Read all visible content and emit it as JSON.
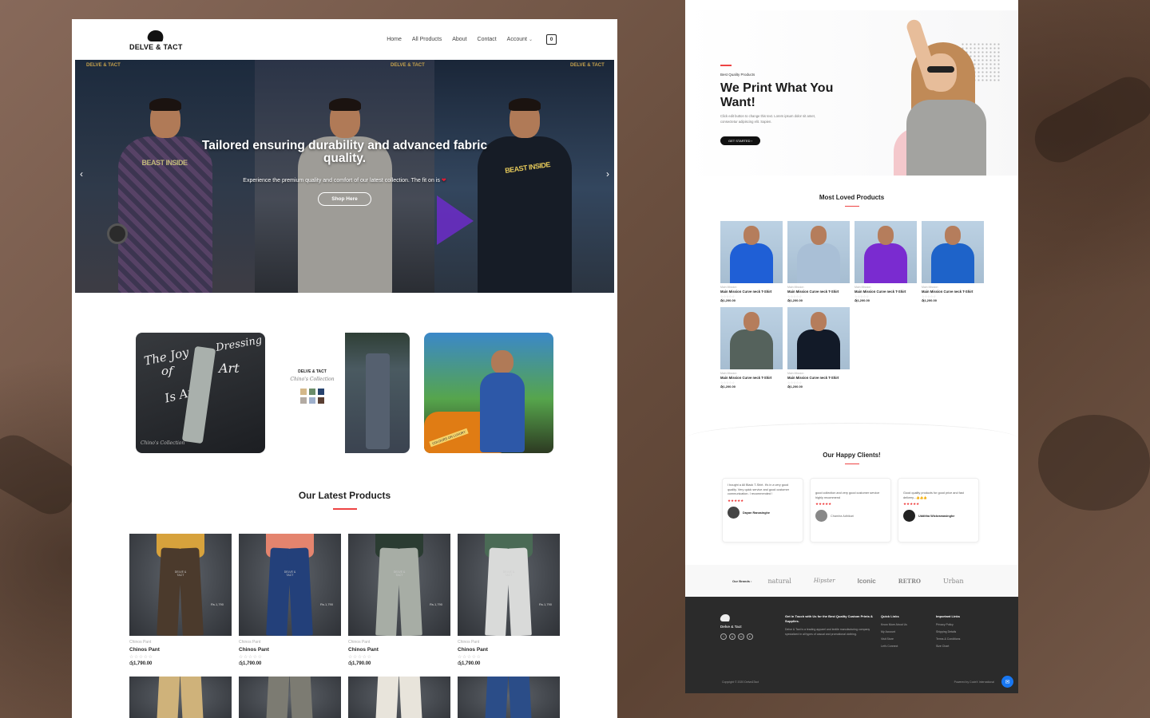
{
  "left": {
    "nav": {
      "brand": "DELVE & TACT",
      "links": [
        "Home",
        "All Products",
        "About",
        "Contact",
        "Account"
      ],
      "cart_count": "0"
    },
    "hero": {
      "brand_tag": "DELVE & TACT",
      "title": "Tailored ensuring durability and advanced fabric quality.",
      "subtitle": "Experience the premium quality and comfort of our latest collection. The fit on is",
      "button": "Shop Here",
      "panel_print_left": "BEAST INSIDE",
      "panel_print_right": "BEAST INSIDE"
    },
    "collections": {
      "card1_text": [
        "The Joy",
        "of",
        "Is An",
        "Dressing",
        "Art"
      ],
      "card1_footer": "Chino's Collection",
      "card2_brand": "DELVE & TACT",
      "card2_script": "Chino's Collection",
      "card3_plate": "COLOURS ON LUXURY"
    },
    "latest": {
      "title": "Our Latest Products",
      "products": [
        {
          "category": "Chinos Pant",
          "name": "Chinos Pant",
          "price": "රු1,790.00",
          "tag": "Rs.1,790",
          "pants": "#4b3a2c",
          "shirt": "#d7a23c"
        },
        {
          "category": "Chinos Pant",
          "name": "Chinos Pant",
          "price": "රු1,790.00",
          "tag": "Rs.1,790",
          "pants": "#23407a",
          "shirt": "#e4846e"
        },
        {
          "category": "Chinos Pant",
          "name": "Chinos Pant",
          "price": "රු1,790.00",
          "tag": "Rs.1,790",
          "pants": "#a7ada5",
          "shirt": "#2b3c32"
        },
        {
          "category": "Chinos Pant",
          "name": "Chinos Pant",
          "price": "රු1,790.00",
          "tag": "Rs.1,790",
          "pants": "#d9dad9",
          "shirt": "#4a6a55"
        }
      ],
      "stars": "☆☆☆☆☆"
    }
  },
  "right": {
    "hero": {
      "eyebrow": "Best Quality Products",
      "title": "We Print What You Want!",
      "description": "Click edit button to change this text. Lorem ipsum dolor sit amet, consectetur adipiscing elit. Sapien.",
      "button": "GET STARTED"
    },
    "most_loved": {
      "title": "Most Loved Products",
      "products": [
        {
          "category": "Main Mission",
          "name": "Main Mission Curve neck T-Shirt",
          "price": "රු1,200.00",
          "color": "#1f5fd6"
        },
        {
          "category": "Main Mission",
          "name": "Main Mission Curve neck T-Shirt",
          "price": "රු1,200.00",
          "color": "#a9bfd6"
        },
        {
          "category": "Main Mission",
          "name": "Main Mission Curve neck T-Shirt",
          "price": "රු1,200.00",
          "color": "#7a2bd0"
        },
        {
          "category": "Main Mission",
          "name": "Main Mission Curve neck T-Shirt",
          "price": "රු1,200.00",
          "color": "#1e63c9"
        },
        {
          "category": "Main Mission",
          "name": "Main Mission Curve neck T-Shirt",
          "price": "රු1,200.00",
          "color": "#55625c"
        },
        {
          "category": "Main Mission",
          "name": "Main Mission Curve neck T-Shirt",
          "price": "රු1,200.00",
          "color": "#121a28"
        }
      ],
      "stars": "☆☆☆☆☆"
    },
    "clients": {
      "title": "Our Happy Clients!",
      "reviews": [
        {
          "text": "I bought a All Black T-Shirt. It's in a very good quality. Very quick service and good customer communication. I recommended !",
          "stars": "★★★★★",
          "name": "Dayan Ranasinghe"
        },
        {
          "text": "good collection and very good customer service highly recommend",
          "stars": "★★★★★",
          "name": "Chamira Adhikari"
        },
        {
          "text": "Good quality products for good price and fast delivery...👍👍👍",
          "stars": "★★★★★",
          "name": "Udditha Wickramasinghe"
        }
      ]
    },
    "brands": {
      "label": "Our Brands :",
      "items": [
        "natural",
        "Hipster",
        "Iconic",
        "RETRO",
        "Urban"
      ]
    },
    "footer": {
      "brand": "Delve & Tact",
      "socials": [
        "f",
        "ig",
        "tw",
        "in"
      ],
      "touch_heading": "Get in Touch with Us for the Best Quality Custom Prints & Supplies.",
      "touch_text": "Delve & Tact is a leading apparel and textile manufacturing company specialized in all types of casual and promotional clothing.",
      "quick_heading": "Quick Links",
      "quick_links": [
        "Know More About Us",
        "My Account",
        "Visit Store",
        "Let's Connect"
      ],
      "important_heading": "Important Links",
      "important_links": [
        "Privacy Policy",
        "Shipping Details",
        "Terms & Conditions",
        "Size Chart"
      ],
      "copyright": "Copyright © 2020 Delve&Tact",
      "powered": "Powered by CodeX International"
    }
  }
}
